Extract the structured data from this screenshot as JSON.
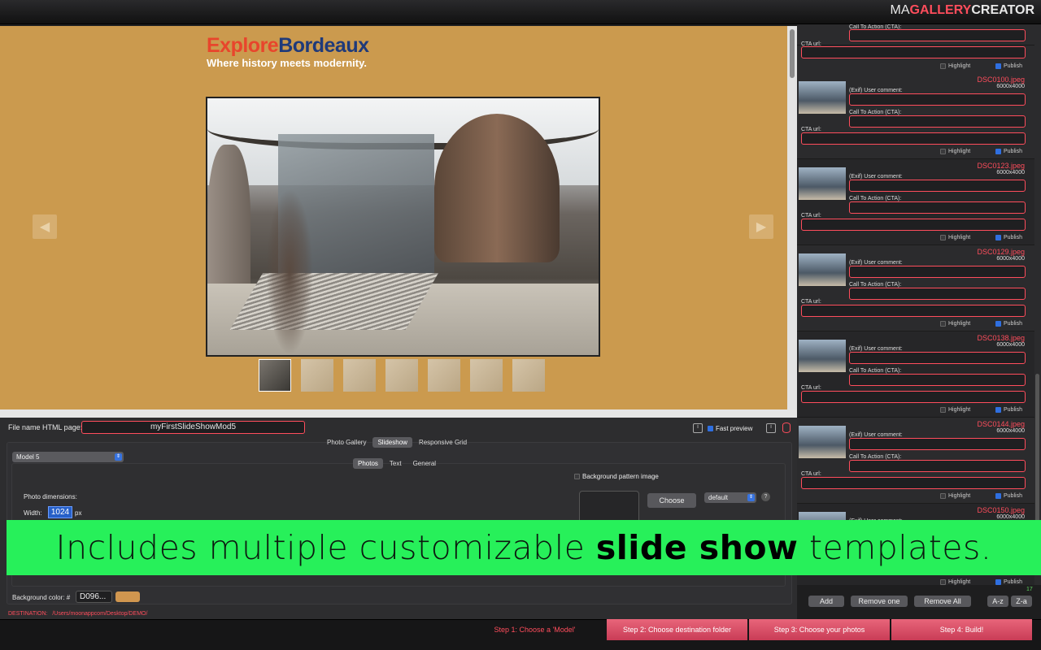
{
  "brand": {
    "prefix": "MA",
    "mid": "GALLERY",
    "suffix": "CREATOR"
  },
  "preview": {
    "title_part1": "Explore",
    "title_part2": "Bordeaux",
    "subtitle": "Where history meets modernity.",
    "prev_glyph": "◀",
    "next_glyph": "▶",
    "thumbnail_count": 7
  },
  "items_common": {
    "exif_label": "(Exif) User comment:",
    "cta_label": "Call To Action (CTA):",
    "cta_url_label": "CTA url:",
    "highlight_label": "Highlight",
    "publish_label": "Publish"
  },
  "photo_items": [
    {
      "name": "DSC0100.jpeg",
      "dims": "6000x4000"
    },
    {
      "name": "DSC0123.jpeg",
      "dims": "6000x4000"
    },
    {
      "name": "DSC0129.jpeg",
      "dims": "6000x4000"
    },
    {
      "name": "DSC0138.jpeg",
      "dims": "6000x4000"
    },
    {
      "name": "DSC0144.jpeg",
      "dims": "6000x4000"
    },
    {
      "name": "DSC0150.jpeg",
      "dims": "6000x4000"
    }
  ],
  "file_name": {
    "label": "File name HTML page:",
    "value": "myFirstSlideShowMod5"
  },
  "fast_preview": {
    "label": "Fast preview",
    "checked": true
  },
  "mode_tabs": [
    "Photo Gallery",
    "Slideshow",
    "Responsive Grid"
  ],
  "model_select": "Model 5",
  "sub_tabs": [
    "Photos",
    "Text",
    "General"
  ],
  "dimensions": {
    "label": "Photo dimensions:",
    "width_label": "Width:",
    "width_value": "1024",
    "unit": "px"
  },
  "background_pattern": {
    "label": "Background pattern image",
    "choose": "Choose",
    "mode": "default",
    "help": "?"
  },
  "background_color": {
    "label": "Background color: #",
    "value": "D096..."
  },
  "destination": {
    "label": "DESTINATION:",
    "path": "/Users/moonappcom/Desktop/DEMO/"
  },
  "banner": {
    "pre": "Includes multiple customizable ",
    "bold": "slide show",
    "post": " templates."
  },
  "right_buttons": {
    "add": "Add",
    "remove_one": "Remove one",
    "remove_all": "Remove All",
    "sort_az": "A-z",
    "sort_za": "Z-a",
    "count": "17"
  },
  "steps": [
    "Step 1: Choose a 'Model'",
    "Step 2: Choose destination folder",
    "Step 3: Choose your photos",
    "Step 4: Build!"
  ],
  "colors": {
    "accent": "#ff4d5c",
    "preview_bg": "#cb9a4e",
    "banner": "#27f05a"
  }
}
